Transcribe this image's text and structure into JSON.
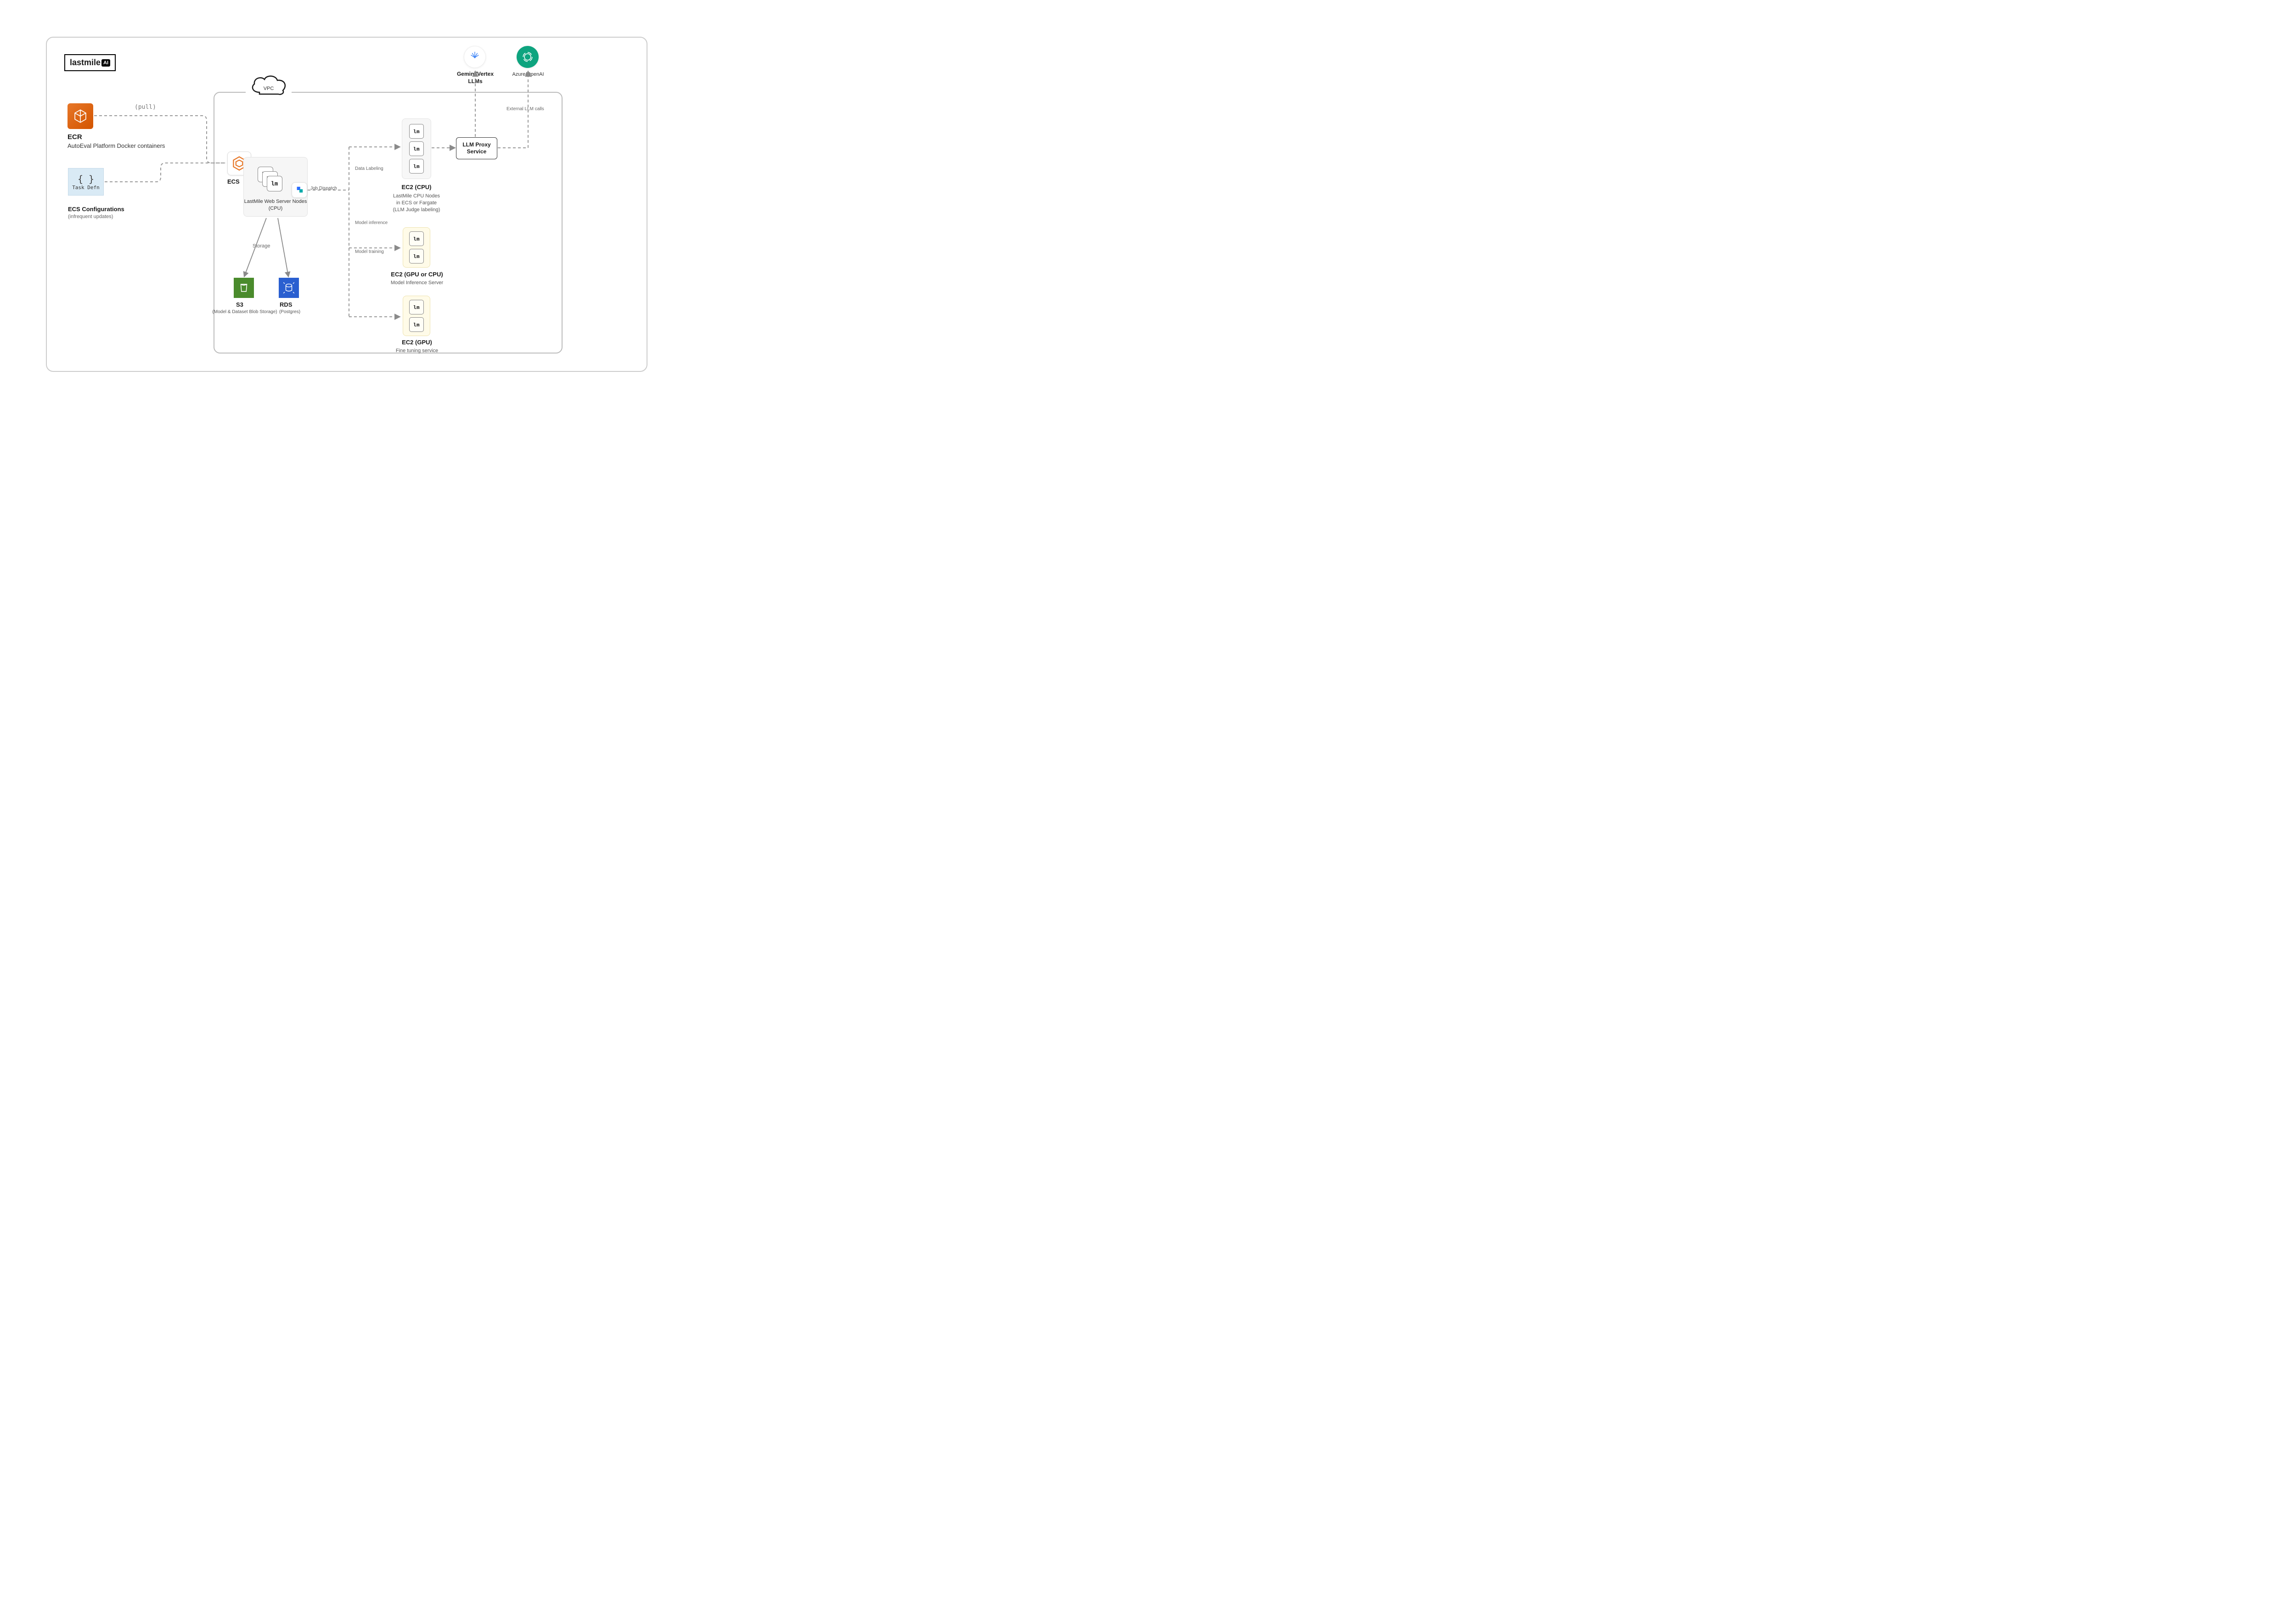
{
  "logo": {
    "brand": "lastmile",
    "badge": "AI"
  },
  "vpc_label": "VPC",
  "pull_label": "(pull)",
  "ecr": {
    "title": "ECR",
    "subtitle": "AutoEval Platform Docker containers"
  },
  "task_defn": {
    "braces": "{ }",
    "caption": "Task Defn"
  },
  "ecs_conf": {
    "title": "ECS Configurations",
    "subtitle": "(infrequent updates)"
  },
  "ecs_label": "ECS",
  "web_server": {
    "label_line1": "LastMile Web Server Nodes",
    "label_line2": "(CPU)",
    "chip": "lm"
  },
  "job_dispatch": "Job Dispatch",
  "branch_labels": {
    "data_labeling": "Data Labeling",
    "model_inference": "Model inference",
    "model_training": "Model training",
    "storage": "Storage",
    "external_llm": "External LLM calls"
  },
  "ec2_cpu": {
    "title": "EC2 (CPU)",
    "sub_line1": "LastMile CPU Nodes",
    "sub_line2": "in ECS or Fargate",
    "sub_line3": "(LLM Judge labeling)",
    "chip": "lm"
  },
  "llm_proxy": {
    "line1": "LLM Proxy",
    "line2": "Service"
  },
  "gemini": {
    "label_line1": "Gemini/Vertex",
    "label_line2": "LLMs"
  },
  "openai": {
    "label": "Azure/OpenAI"
  },
  "ec2_gpu_cpu": {
    "title": "EC2 (GPU or CPU)",
    "subtitle": "Model Inference Server",
    "chip": "lm"
  },
  "ec2_gpu": {
    "title": "EC2 (GPU)",
    "subtitle": "Fine tuning service",
    "chip": "lm"
  },
  "s3": {
    "title": "S3",
    "subtitle": "(Model & Dataset Blob Storage)"
  },
  "rds": {
    "title": "RDS",
    "subtitle": "(Postgres)"
  }
}
